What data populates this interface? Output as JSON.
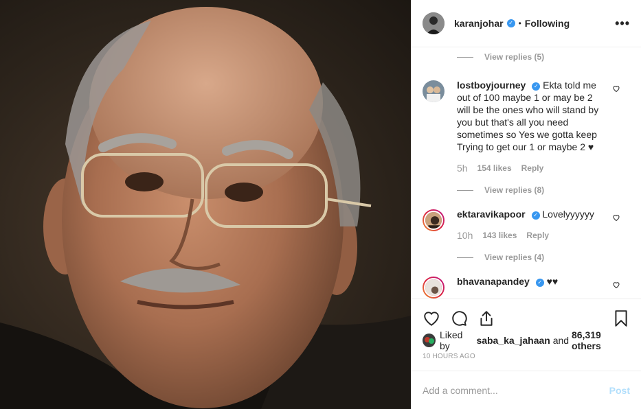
{
  "post": {
    "author": "karanjohar",
    "follow_status": "Following",
    "dot": "•",
    "more_label": "•••"
  },
  "comments": [
    {
      "type": "replies",
      "label": "View replies (5)"
    },
    {
      "type": "comment",
      "user": "lostboyjourney",
      "text": "Ekta told me out of 100 maybe 1 or may be 2 will be the ones who will stand by you but that's all you need sometimes so Yes we gotta keep Trying to get our 1 or maybe 2 ♥",
      "time": "5h",
      "likes": "154 likes",
      "reply": "Reply"
    },
    {
      "type": "replies",
      "label": "View replies (8)"
    },
    {
      "type": "comment",
      "user": "ektaravikapoor",
      "text": "Lovelyyyyyy",
      "time": "10h",
      "likes": "143 likes",
      "reply": "Reply"
    },
    {
      "type": "replies",
      "label": "View replies (4)"
    },
    {
      "type": "comment",
      "user": "bhavanapandey",
      "text": "♥♥"
    }
  ],
  "likes": {
    "prefix": "Liked by",
    "user": "saba_ka_jahaan",
    "joiner": "and",
    "others": "86,319 others"
  },
  "timestamp": "10 HOURS AGO",
  "add_comment": {
    "placeholder": "Add a comment...",
    "post_label": "Post"
  },
  "colors": {
    "verified": "#3897f0",
    "secondary_text": "#999999",
    "post_disabled": "#b2dffc",
    "border": "#efefef"
  }
}
